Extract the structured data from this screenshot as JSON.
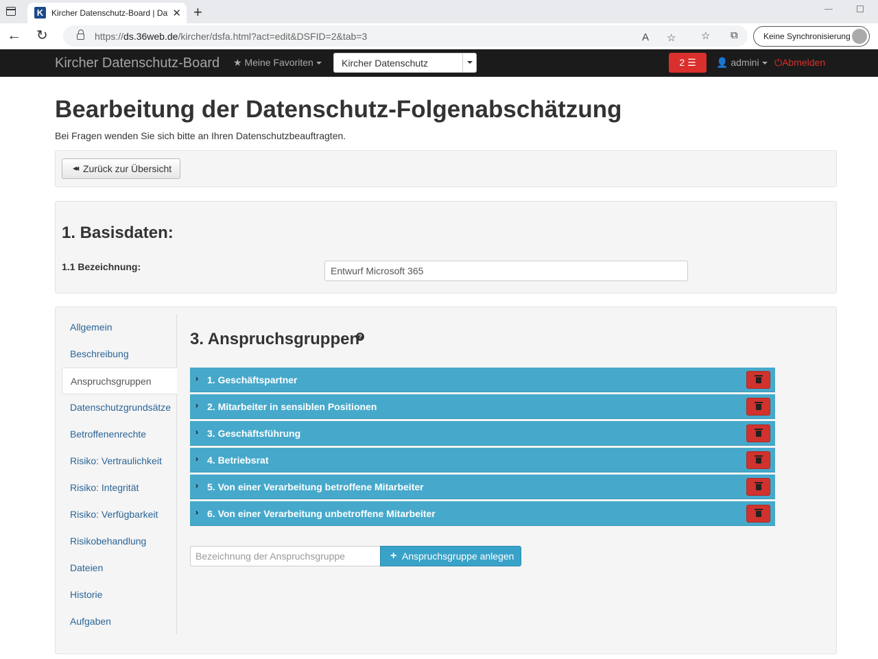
{
  "browser": {
    "tab_title": "Kircher Datenschutz-Board | Datenschutz",
    "url_prefix": "https://",
    "url_domain": "ds.36web.de",
    "url_path": "/kircher/dsfa.html?act=edit&DSFID=2&tab=3",
    "sync_label": "Keine Synchronisierung"
  },
  "navbar": {
    "brand": "Kircher Datenschutz-Board",
    "favorites": "Meine Favoriten",
    "org_selected": "Kircher Datenschutz",
    "task_count": "2",
    "user": "admini",
    "logout": "Abmelden",
    "logout_color": "#d9302d"
  },
  "page": {
    "title": "Bearbeitung der Datenschutz-Folgenabschätzung",
    "subtitle": "Bei Fragen wenden Sie sich bitte an Ihren Datenschutzbeauftragten.",
    "back_button": "Zurück zur Übersicht"
  },
  "basis": {
    "heading": "1. Basisdaten:",
    "label": "1.1 Bezeichnung:",
    "value": "Entwurf Microsoft 365"
  },
  "sidebar": {
    "items": [
      {
        "label": "Allgemein"
      },
      {
        "label": "Beschreibung"
      },
      {
        "label": "Anspruchsgruppen"
      },
      {
        "label": "Datenschutzgrundsätze"
      },
      {
        "label": "Betroffenenrechte"
      },
      {
        "label": "Risiko: Vertraulichkeit"
      },
      {
        "label": "Risiko: Integrität"
      },
      {
        "label": "Risiko: Verfügbarkeit"
      },
      {
        "label": "Risikobehandlung"
      },
      {
        "label": "Dateien"
      },
      {
        "label": "Historie"
      },
      {
        "label": "Aufgaben"
      }
    ],
    "active_index": 2
  },
  "section": {
    "heading": "3. Anspruchsgruppen",
    "groups": [
      {
        "name": "1. Geschäftspartner"
      },
      {
        "name": "2. Mitarbeiter in sensiblen Positionen"
      },
      {
        "name": "3. Geschäftsführung"
      },
      {
        "name": "4. Betriebsrat"
      },
      {
        "name": "5. Von einer Verarbeitung betroffene Mitarbeiter"
      },
      {
        "name": "6. Von einer Verarbeitung unbetroffene Mitarbeiter"
      }
    ],
    "new_placeholder": "Bezeichnung der Anspruchsgruppe",
    "new_button": "Anspruchsgruppe anlegen",
    "row_color": "#46a9cb",
    "delete_color": "#d2322d"
  }
}
